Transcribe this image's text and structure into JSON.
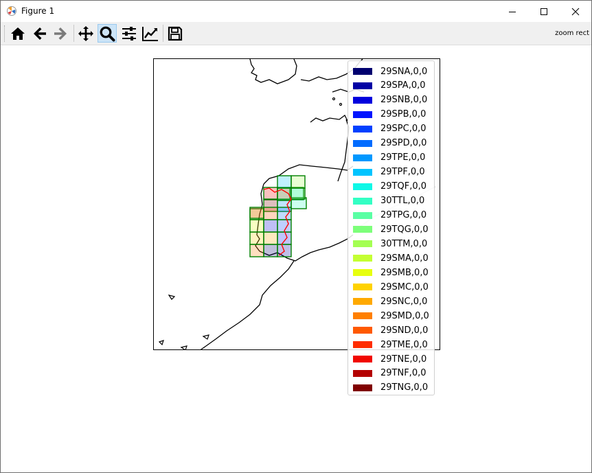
{
  "window": {
    "title": "Figure 1",
    "minimize_glyph": "—",
    "maximize_glyph": "☐",
    "close_glyph": "✕"
  },
  "toolbar": {
    "buttons": [
      {
        "name": "home-icon",
        "active": false
      },
      {
        "name": "back-arrow-icon",
        "active": false
      },
      {
        "name": "forward-arrow-icon",
        "active": false
      },
      {
        "name": "pan-icon",
        "active": false
      },
      {
        "name": "zoom-icon",
        "active": true
      },
      {
        "name": "subplots-icon",
        "active": false
      },
      {
        "name": "edit-curve-icon",
        "active": false
      },
      {
        "name": "save-icon",
        "active": false
      }
    ],
    "status_text": "zoom rect",
    "active_color": "#cce4f7"
  },
  "legend": {
    "entries": [
      {
        "label": "29SNA,0,0",
        "color": "#00006f"
      },
      {
        "label": "29SPA,0,0",
        "color": "#0000a4"
      },
      {
        "label": "29SNB,0,0",
        "color": "#0000dd"
      },
      {
        "label": "29SPB,0,0",
        "color": "#0014ff"
      },
      {
        "label": "29SPC,0,0",
        "color": "#0040ff"
      },
      {
        "label": "29SPD,0,0",
        "color": "#006cff"
      },
      {
        "label": "29TPE,0,0",
        "color": "#0098ff"
      },
      {
        "label": "29TPF,0,0",
        "color": "#00c4ff"
      },
      {
        "label": "29TQF,0,0",
        "color": "#0ff8e7"
      },
      {
        "label": "30TTL,0,0",
        "color": "#33ffc4"
      },
      {
        "label": "29TPG,0,0",
        "color": "#5affa4"
      },
      {
        "label": "29TQG,0,0",
        "color": "#7dff7a"
      },
      {
        "label": "30TTM,0,0",
        "color": "#a4ff53"
      },
      {
        "label": "29SMA,0,0",
        "color": "#c4ff33"
      },
      {
        "label": "29SMB,0,0",
        "color": "#e7ff0f"
      },
      {
        "label": "29SMC,0,0",
        "color": "#ffd200"
      },
      {
        "label": "29SNC,0,0",
        "color": "#ffa900"
      },
      {
        "label": "29SMD,0,0",
        "color": "#ff7f00"
      },
      {
        "label": "29SND,0,0",
        "color": "#ff5900"
      },
      {
        "label": "29TME,0,0",
        "color": "#ff2d00"
      },
      {
        "label": "29TNE,0,0",
        "color": "#f10700"
      },
      {
        "label": "29TNF,0,0",
        "color": "#b40000"
      },
      {
        "label": "29TNG,0,0",
        "color": "#800000"
      }
    ]
  },
  "map": {
    "tile_edge_color": "#008000",
    "border_color": "#ff0000",
    "coastline_color": "#000000"
  }
}
